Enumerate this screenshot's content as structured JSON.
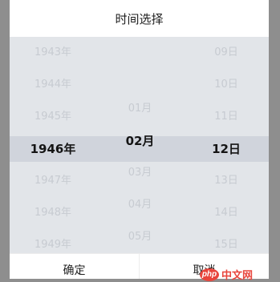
{
  "header": {
    "title": "时间选择"
  },
  "picker": {
    "years": [
      "1943年",
      "1944年",
      "1945年",
      "1946年",
      "1947年",
      "1948年",
      "1949年"
    ],
    "months": [
      "",
      "",
      "01月",
      "02月",
      "03月",
      "04月",
      "05月"
    ],
    "days": [
      "09日",
      "10日",
      "11日",
      "12日",
      "13日",
      "14日",
      "15日"
    ],
    "selected": {
      "year": "1946年",
      "month": "02月",
      "day": "12日"
    }
  },
  "footer": {
    "confirm_label": "确定",
    "cancel_label": "取消"
  },
  "watermark": {
    "logo_text": "php",
    "site_text": "中文网"
  },
  "colors": {
    "overlay": "#8e8e8e",
    "picker_bg": "#e2e5e9",
    "selection_band": "#d0d4dc",
    "faded_text": "#c7cbd1",
    "selected_text": "#141414",
    "watermark": "#e8453c"
  }
}
